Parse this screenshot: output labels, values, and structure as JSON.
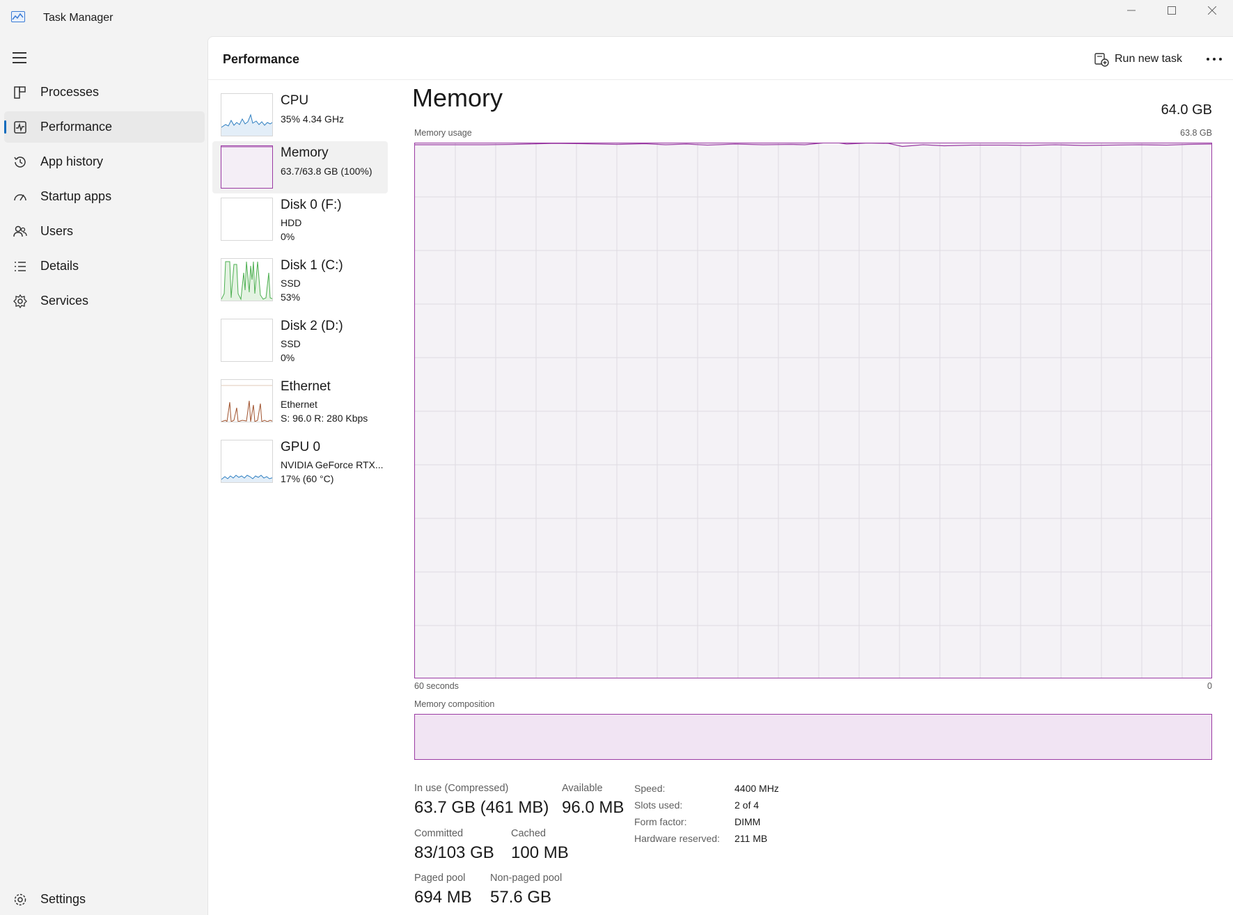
{
  "window": {
    "title": "Task Manager",
    "controls": [
      "minimize",
      "maximize",
      "close"
    ]
  },
  "nav": {
    "items": [
      {
        "label": "Processes",
        "icon": "processes-icon"
      },
      {
        "label": "Performance",
        "icon": "performance-icon",
        "active": true
      },
      {
        "label": "App history",
        "icon": "app-history-icon"
      },
      {
        "label": "Startup apps",
        "icon": "startup-apps-icon"
      },
      {
        "label": "Users",
        "icon": "users-icon"
      },
      {
        "label": "Details",
        "icon": "details-icon"
      },
      {
        "label": "Services",
        "icon": "services-icon"
      }
    ],
    "settings_label": "Settings"
  },
  "header": {
    "title": "Performance",
    "run_new_task_label": "Run new task"
  },
  "devices": [
    {
      "name": "CPU",
      "line1": "35%  4.34 GHz",
      "line2": "",
      "color": "#2f7fc1"
    },
    {
      "name": "Memory",
      "line1": "63.7/63.8 GB (100%)",
      "line2": "",
      "color": "#9a3aa3",
      "active": true
    },
    {
      "name": "Disk 0 (F:)",
      "line1": "HDD",
      "line2": "0%",
      "color": "#4caf50"
    },
    {
      "name": "Disk 1 (C:)",
      "line1": "SSD",
      "line2": "53%",
      "color": "#4caf50"
    },
    {
      "name": "Disk 2 (D:)",
      "line1": "SSD",
      "line2": "0%",
      "color": "#4caf50"
    },
    {
      "name": "Ethernet",
      "line1": "Ethernet",
      "line2": "S: 96.0  R: 280 Kbps",
      "color": "#a0522d"
    },
    {
      "name": "GPU 0",
      "line1": "NVIDIA GeForce RTX...",
      "line2": "17%  (60 °C)",
      "color": "#2f7fc1"
    }
  ],
  "memory": {
    "title": "Memory",
    "total": "64.0 GB",
    "usage_label": "Memory usage",
    "usage_max": "63.8 GB",
    "time_left": "60 seconds",
    "time_right": "0",
    "composition_label": "Memory composition",
    "stats": {
      "in_use_label": "In use (Compressed)",
      "in_use_value": "63.7 GB (461 MB)",
      "available_label": "Available",
      "available_value": "96.0 MB",
      "committed_label": "Committed",
      "committed_value": "83/103 GB",
      "cached_label": "Cached",
      "cached_value": "100 MB",
      "paged_label": "Paged pool",
      "paged_value": "694 MB",
      "nonpaged_label": "Non-paged pool",
      "nonpaged_value": "57.6 GB"
    },
    "specs": {
      "speed_label": "Speed:",
      "speed_value": "4400 MHz",
      "slots_label": "Slots used:",
      "slots_value": "2 of 4",
      "form_label": "Form factor:",
      "form_value": "DIMM",
      "reserved_label": "Hardware reserved:",
      "reserved_value": "211 MB"
    },
    "accent": "#9a3aa3"
  }
}
